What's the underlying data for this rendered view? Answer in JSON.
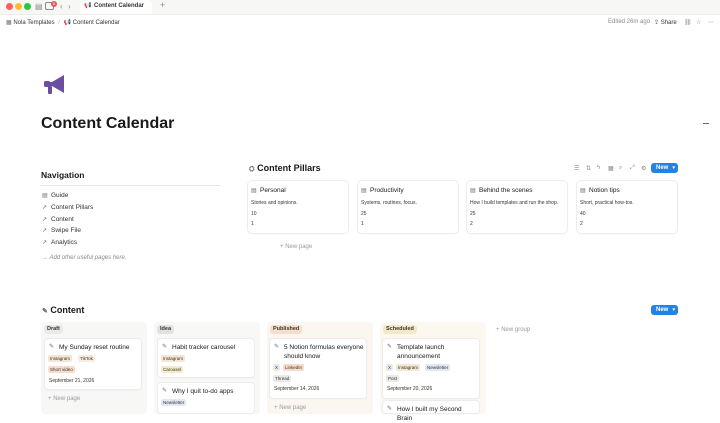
{
  "window": {
    "tab_title": "Content Calendar",
    "badge": "6"
  },
  "breadcrumb": {
    "workspace": "Nola Templates",
    "page": "Content Calendar"
  },
  "topbar": {
    "edited": "Edited 26m ago",
    "share": "Share"
  },
  "page": {
    "title": "Content Calendar"
  },
  "navigation": {
    "title": "Navigation",
    "items": [
      "Guide",
      "Content Pillars",
      "Content",
      "Swipe File",
      "Analytics"
    ],
    "note": "→ Add other useful pages here."
  },
  "pillars": {
    "title": "Content Pillars",
    "new_label": "New",
    "new_page": "New page",
    "cards": [
      {
        "title": "Personal",
        "desc": "Stories and opinions.",
        "n1": "10",
        "n2": "1"
      },
      {
        "title": "Productivity",
        "desc": "Systems, routines, focus.",
        "n1": "25",
        "n2": "1"
      },
      {
        "title": "Behind the scenes",
        "desc": "How I build templates and run the shop.",
        "n1": "25",
        "n2": "2"
      },
      {
        "title": "Notion tips",
        "desc": "Short, practical how-tos.",
        "n1": "40",
        "n2": "2"
      }
    ]
  },
  "content": {
    "title": "Content",
    "new_label": "New",
    "new_group": "New group",
    "new_page": "New page",
    "columns": [
      {
        "name": "Draft",
        "color": "#e9e9e7",
        "bg": "#f7f7f5"
      },
      {
        "name": "Idea",
        "color": "#e3e2e0",
        "bg": "#f8f8f7"
      },
      {
        "name": "Published",
        "color": "#f5dfcc",
        "bg": "#fcf6f1"
      },
      {
        "name": "Scheduled",
        "color": "#f3e9c9",
        "bg": "#fbf8ef"
      }
    ],
    "cards": {
      "c1": {
        "title": "My Sunday reset routine",
        "tags": [
          "Instagram",
          "TikTok"
        ],
        "format": "Short video",
        "date": "September 21, 2026"
      },
      "c2": {
        "title": "Habit tracker carousel",
        "tags": [
          "Instagram"
        ],
        "format": "Carousel"
      },
      "c3": {
        "title": "Why I quit to-do apps",
        "tags": [
          "Newsletter"
        ]
      },
      "c4": {
        "title": "5 Notion formulas everyone should know",
        "tags": [
          "X",
          "LinkedIn"
        ],
        "format": "Thread",
        "date": "September 14, 2026"
      },
      "c5": {
        "title": "Template launch announcement",
        "tags": [
          "X",
          "Instagram",
          "Newsletter"
        ],
        "format": "Post",
        "date": "September 20, 2026"
      },
      "c6": {
        "title": "How I built my Second Brain"
      }
    }
  },
  "colors": {
    "accent": "#2383e2",
    "icon_purple": "#6b4f9e"
  }
}
